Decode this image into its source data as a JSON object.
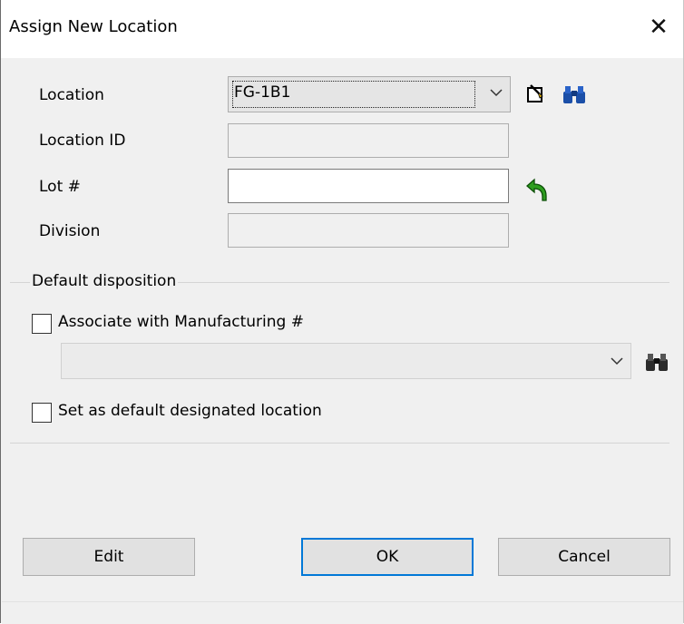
{
  "window": {
    "title": "Assign New Location",
    "close_symbol": "✕"
  },
  "form": {
    "location_label": "Location",
    "location_value": "FG-1B1",
    "location_id_label": "Location ID",
    "location_id_value": "",
    "lot_label": "Lot #",
    "lot_value": "",
    "division_label": "Division",
    "division_value": ""
  },
  "default_disposition": {
    "group_label": "Default disposition",
    "associate_label": "Associate with Manufacturing #",
    "associate_checked": false,
    "manufacturing_value": "",
    "default_designated_label": "Set as default designated location",
    "default_designated_checked": false
  },
  "buttons": {
    "edit": "Edit",
    "ok": "OK",
    "cancel": "Cancel"
  },
  "icons": [
    "chevron-down-icon",
    "new-record-icon",
    "binoculars-icon",
    "undo-arrow-icon"
  ],
  "colors": {
    "accent": "#0078d7",
    "undo_icon": "#2e9e1f",
    "binoculars": "#1b4fa8"
  }
}
